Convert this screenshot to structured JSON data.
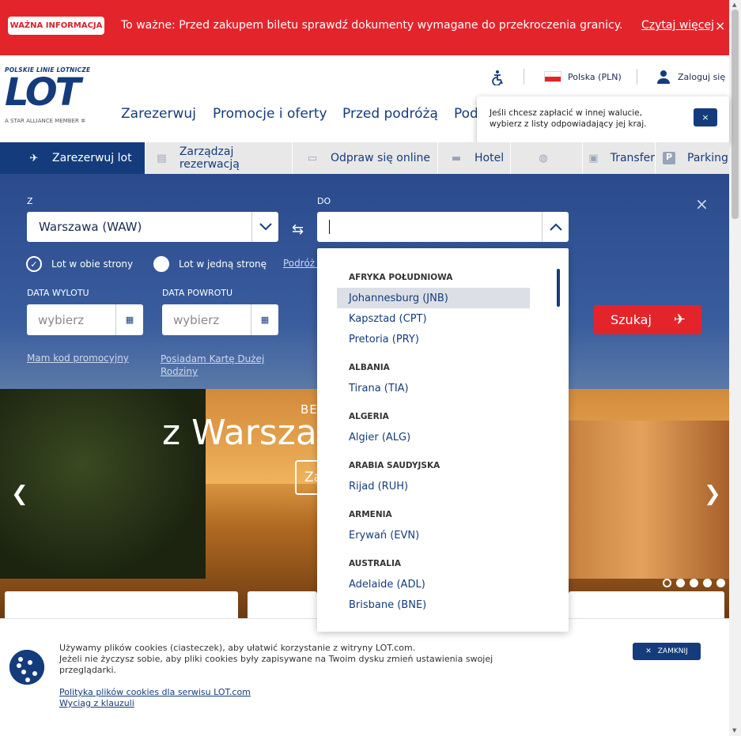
{
  "alert": {
    "badge": "WAŻNA INFORMACJA",
    "message": "To ważne: Przed zakupem biletu sprawdź dokumenty wymagane do przekroczenia granicy. » Sprawdź szc",
    "more": "Czytaj więcej",
    "close": "×"
  },
  "logo": {
    "top": "POLSKIE LINIE LOTNICZE",
    "mark": "LOT",
    "alliance": "A STAR ALLIANCE MEMBER"
  },
  "util": {
    "country": "Polska (PLN)",
    "login": "Zaloguj się"
  },
  "nav": [
    "Zarezerwuj",
    "Promocje i oferty",
    "Przed podróżą",
    "Pod"
  ],
  "tooltip": {
    "text": "Jeśli chcesz zapłacić w innej walucie, wybierz z listy odpowiadający jej kraj.",
    "close": "×"
  },
  "tabs": [
    {
      "label": "Zarezerwuj lot",
      "icon": "plane-icon"
    },
    {
      "label": "Zarządzaj rezerwacją",
      "icon": "ticket-icon"
    },
    {
      "label": "Odpraw się online",
      "icon": "boarding-pass-icon"
    },
    {
      "label": "Hotel",
      "icon": "bed-icon"
    },
    {
      "label": "",
      "icon": "car-rental-icon"
    },
    {
      "label": "Transfer",
      "icon": "taxi-icon"
    },
    {
      "label": "Parking",
      "icon": "parking-icon"
    }
  ],
  "form": {
    "from_label": "Z",
    "from_value": "Warszawa (WAW)",
    "to_label": "DO",
    "to_value": "",
    "round_trip": "Lot w obie strony",
    "one_way": "Lot w jedną stronę",
    "multi": "Podróż w",
    "depart_label": "DATA WYLOTU",
    "return_label": "DATA POWROTU",
    "date_placeholder": "wybierz",
    "promo_link": "Mam kod promocyjny",
    "family_link": "Posiadam Kartę Dużej Rodziny",
    "search": "Szukaj",
    "close": "×"
  },
  "hero": {
    "subtitle": "BE",
    "title": "z Warsza",
    "cta": "Za"
  },
  "dropdown": {
    "groups": [
      {
        "name": "AFRYKA POŁUDNIOWA",
        "items": [
          "Johannesburg (JNB)",
          "Kapsztad (CPT)",
          "Pretoria (PRY)"
        ]
      },
      {
        "name": "ALBANIA",
        "items": [
          "Tirana (TIA)"
        ]
      },
      {
        "name": "ALGERIA",
        "items": [
          "Algier (ALG)"
        ]
      },
      {
        "name": "ARABIA SAUDYJSKA",
        "items": [
          "Rijad (RUH)"
        ]
      },
      {
        "name": "ARMENIA",
        "items": [
          "Erywań (EVN)"
        ]
      },
      {
        "name": "AUSTRALIA",
        "items": [
          "Adelaide (ADL)",
          "Brisbane (BNE)"
        ]
      }
    ],
    "highlighted": "Johannesburg (JNB)"
  },
  "cookie": {
    "line1": "Używamy plików cookies (ciasteczek), aby ułatwić korzystanie z witryny LOT.com.",
    "line2": "Jeżeli nie życzysz sobie, aby pliki cookies były zapisywane na Twoim dysku zmień ustawienia swojej przeglądarki.",
    "policy_link": "Polityka plików cookies dla serwisu LOT.com",
    "clause_link": "Wyciąg z klauzuli",
    "close": "ZAMKNIJ"
  },
  "colors": {
    "brand": "#143c7c",
    "accent": "#e4242b"
  }
}
